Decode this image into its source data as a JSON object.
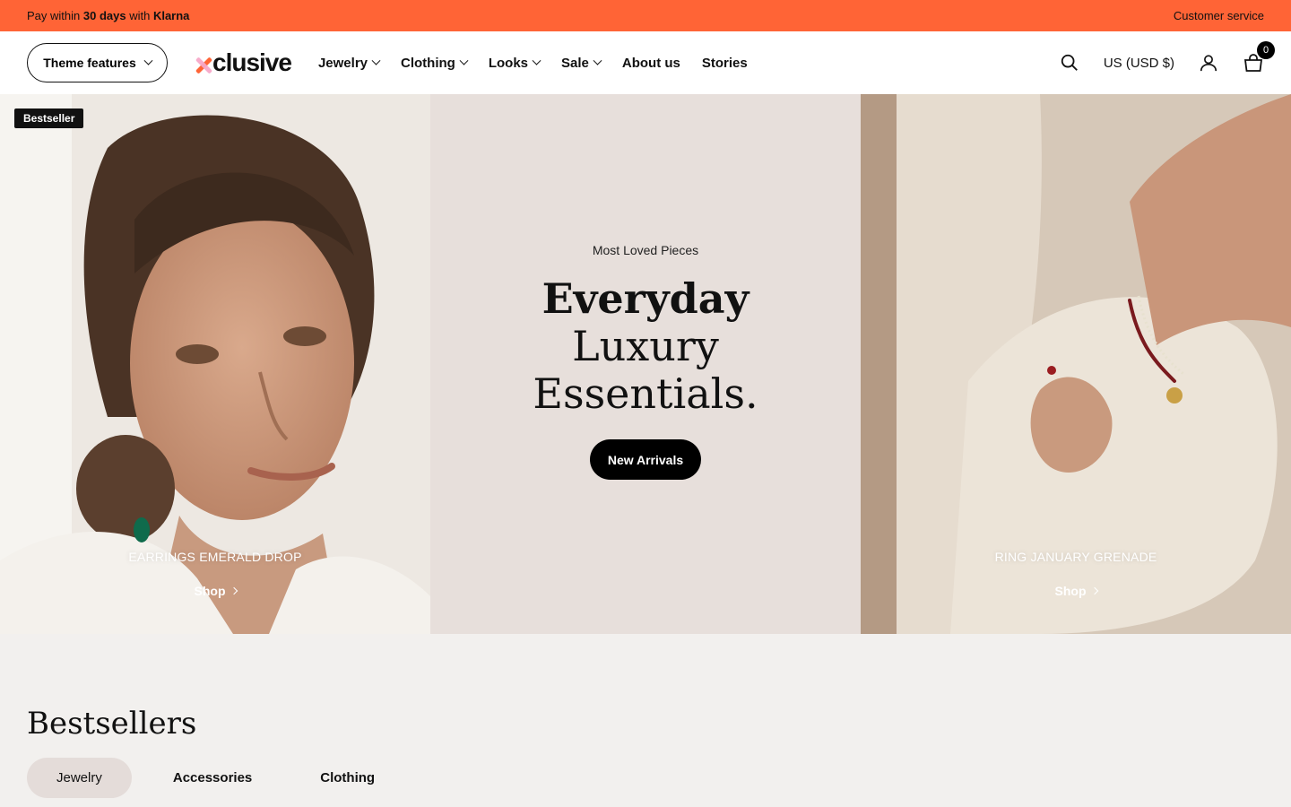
{
  "announcement": {
    "pay_prefix": "Pay within",
    "pay_days": "30 days",
    "pay_with": "with",
    "pay_provider": "Klarna",
    "customer_service": "Customer service"
  },
  "header": {
    "theme_features": "Theme features",
    "logo": "clusive",
    "nav": [
      {
        "label": "Jewelry"
      },
      {
        "label": "Clothing"
      },
      {
        "label": "Looks"
      },
      {
        "label": "Sale"
      },
      {
        "label": "About us"
      },
      {
        "label": "Stories"
      }
    ],
    "currency": "US (USD $)",
    "cart_count": "0"
  },
  "hero": {
    "left": {
      "badge": "Bestseller",
      "title": "EARRINGS EMERALD DROP",
      "shop": "Shop"
    },
    "center": {
      "eyebrow": "Most Loved Pieces",
      "line1": "Everyday",
      "line2": "Luxury",
      "line3": "Essentials.",
      "cta": "New Arrivals"
    },
    "right": {
      "title": "RING JANUARY GRENADE",
      "shop": "Shop"
    }
  },
  "bestsellers": {
    "title": "Bestsellers",
    "tabs": [
      "Jewelry",
      "Accessories",
      "Clothing"
    ]
  },
  "colors": {
    "announcement_bg": "#ff6436",
    "cta_bg": "#000000",
    "center_panel_bg": "#e7dfdb",
    "section_bg": "#f2f0ee"
  }
}
